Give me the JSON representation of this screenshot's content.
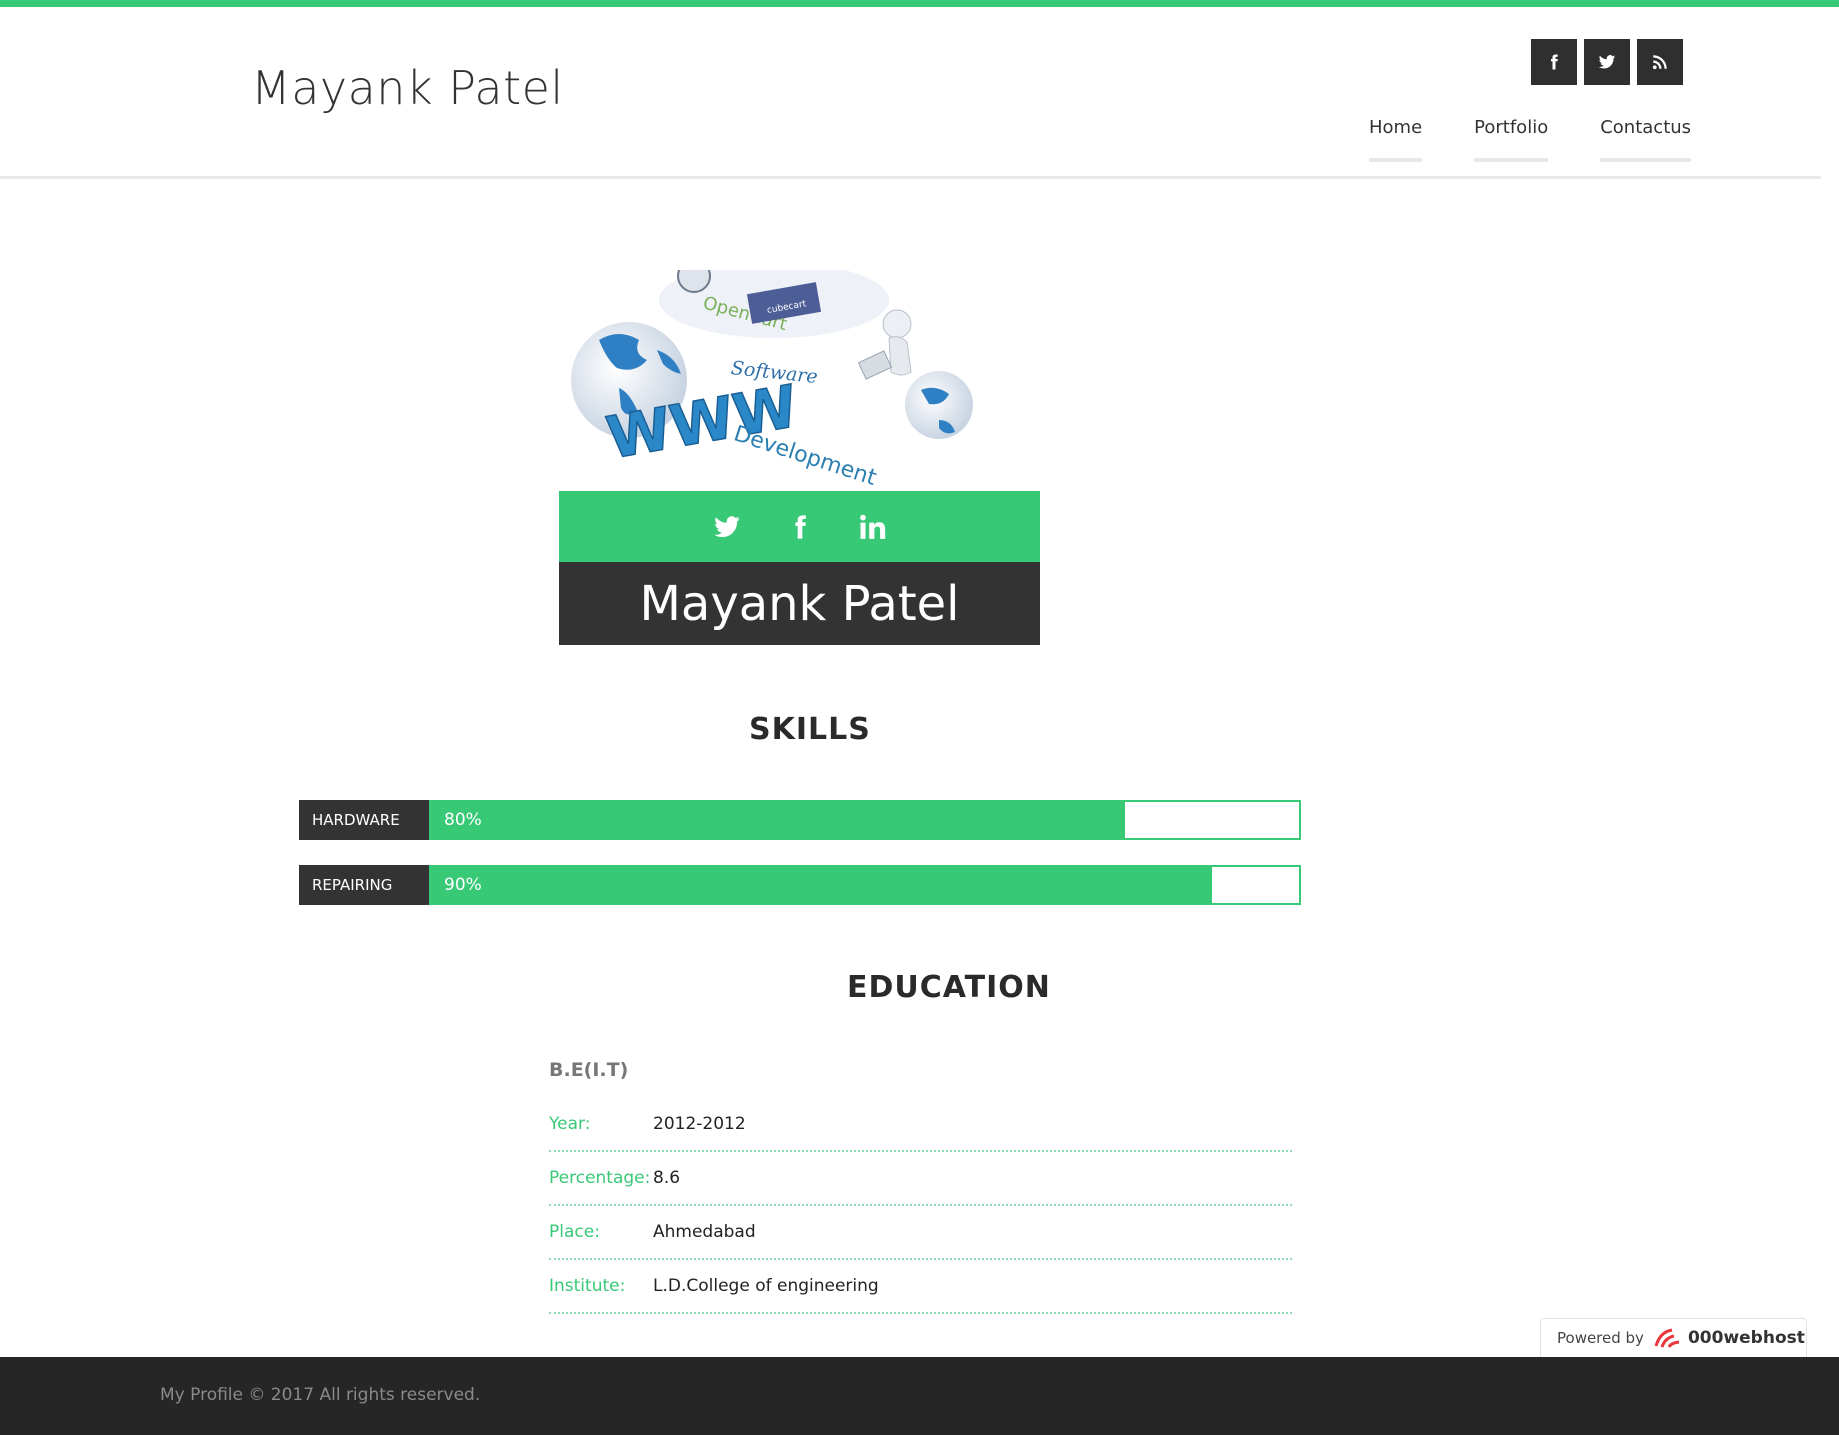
{
  "header": {
    "site_title": "Mayank Patel",
    "social_icons": [
      "facebook-icon",
      "twitter-icon",
      "rss-icon"
    ],
    "nav": [
      {
        "label": "Home"
      },
      {
        "label": "Portfolio"
      },
      {
        "label": "Contactus"
      }
    ]
  },
  "profile": {
    "banner_words": [
      "Software",
      "WWW",
      "Development",
      "OpenCart",
      "cubecart"
    ],
    "social_icons": [
      "twitter-icon",
      "facebook-icon",
      "linkedin-icon"
    ],
    "name": "Mayank Patel"
  },
  "skills": {
    "title": "SKILLS",
    "items": [
      {
        "label": "HARDWARE",
        "percent_text": "80%",
        "percent": 80
      },
      {
        "label": "REPAIRING",
        "percent_text": "90%",
        "percent": 90
      }
    ]
  },
  "education": {
    "title": "EDUCATION",
    "degree": "B.E(I.T)",
    "rows": [
      {
        "key": "Year:",
        "value": "2012-2012"
      },
      {
        "key": "Percentage:",
        "value": "8.6"
      },
      {
        "key": "Place:",
        "value": "Ahmedabad"
      },
      {
        "key": "Institute:",
        "value": "L.D.College of engineering"
      }
    ]
  },
  "badge": {
    "prefix": "Powered by",
    "brand": "000webhost"
  },
  "footer": {
    "copyright": "My Profile © 2017 All rights reserved."
  },
  "colors": {
    "accent": "#38c977",
    "dark": "#333333",
    "footer": "#262626"
  }
}
